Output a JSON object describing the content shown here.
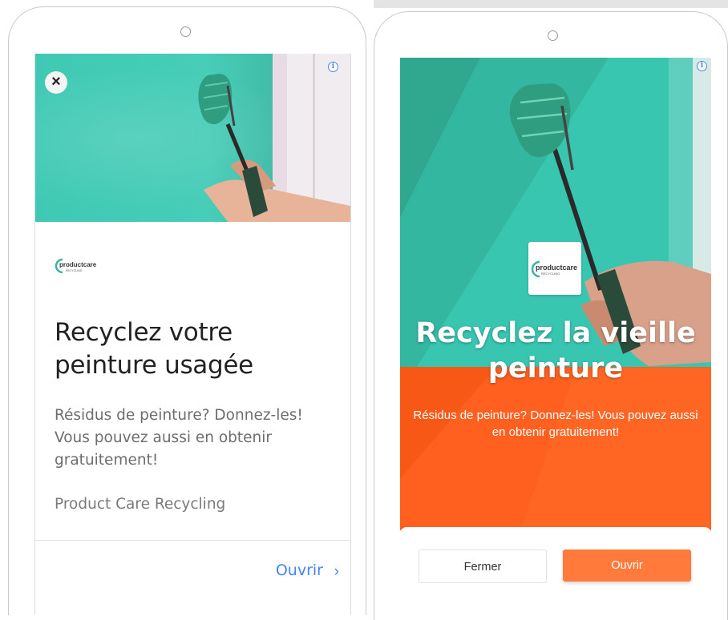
{
  "left_ad": {
    "close_glyph": "×",
    "info_glyph": "i",
    "logo_text": "productcare",
    "logo_sub": "RECYCLING",
    "headline": "Recyclez votre peinture usagée",
    "description": "Résidus de peinture? Donnez-les! Vous pouvez aussi en obtenir gratuitement!",
    "advertiser": "Product Care Recycling",
    "cta_label": "Ouvrir",
    "cta_chevron": "›",
    "link_color": "#4285f4"
  },
  "right_ad": {
    "info_glyph": "i",
    "logo_text": "productcare",
    "logo_sub": "RECYCLING",
    "headline": "Recyclez la vieille peinture",
    "description": "Résidus de peinture? Donnez-les! Vous pouvez aussi en obtenir gratuitement!",
    "close_button_label": "Fermer",
    "open_button_label": "Ouvrir",
    "accent_color": "#ff5f1f",
    "button_color": "#ff7a3b"
  },
  "colors": {
    "teal_wall": "#3fc9b4",
    "orange": "#ff5f1f"
  }
}
